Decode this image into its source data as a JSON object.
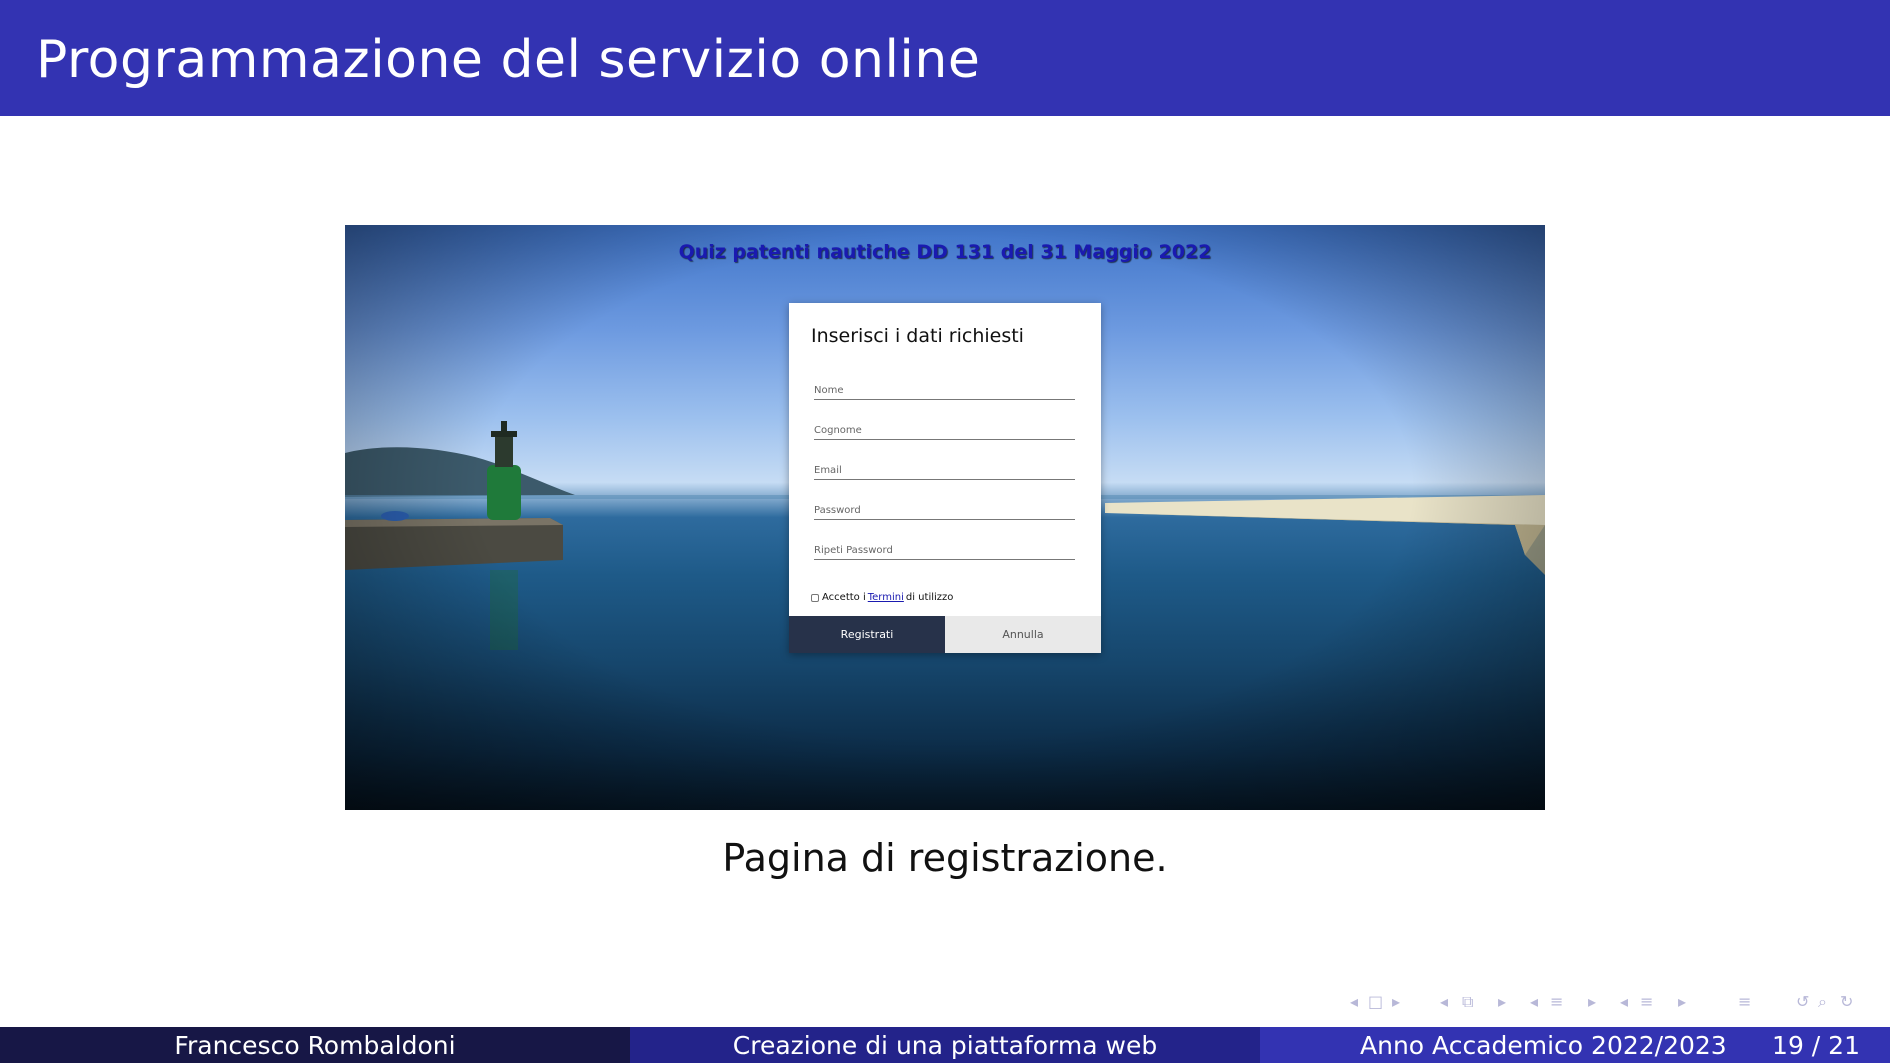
{
  "slide": {
    "title": "Programmazione del servizio online",
    "caption": "Pagina di registrazione."
  },
  "screenshot": {
    "heading": "Quiz patenti nautiche DD 131 del 31 Maggio 2022",
    "form": {
      "title": "Inserisci i dati richiesti",
      "fields": [
        {
          "placeholder": "Nome"
        },
        {
          "placeholder": "Cognome"
        },
        {
          "placeholder": "Email"
        },
        {
          "placeholder": "Password"
        },
        {
          "placeholder": "Ripeti Password"
        }
      ],
      "terms_prefix": "Accetto i",
      "terms_link": "Termini",
      "terms_suffix": "di utilizzo",
      "register_label": "Registrati",
      "cancel_label": "Annulla"
    }
  },
  "footer": {
    "author": "Francesco Rombaldoni",
    "title": "Creazione di una piattaforma web",
    "year": "Anno Accademico 2022/2023",
    "page": "19 / 21"
  },
  "colors": {
    "header": "#3333b2",
    "footer_left": "#171746",
    "footer_mid": "#23238a",
    "footer_right": "#3333b2",
    "register_button": "#27324a"
  },
  "nav_icons": [
    "arrow-left-icon",
    "frame-icon",
    "arrow-right-icon",
    "arrow-left-icon",
    "subsection-icon",
    "arrow-right-icon",
    "arrow-left-icon",
    "section-icon",
    "arrow-right-icon",
    "arrow-left-icon",
    "subsection-list-icon",
    "arrow-right-icon",
    "align-icon",
    "undo-icon",
    "search-icon",
    "redo-icon"
  ]
}
